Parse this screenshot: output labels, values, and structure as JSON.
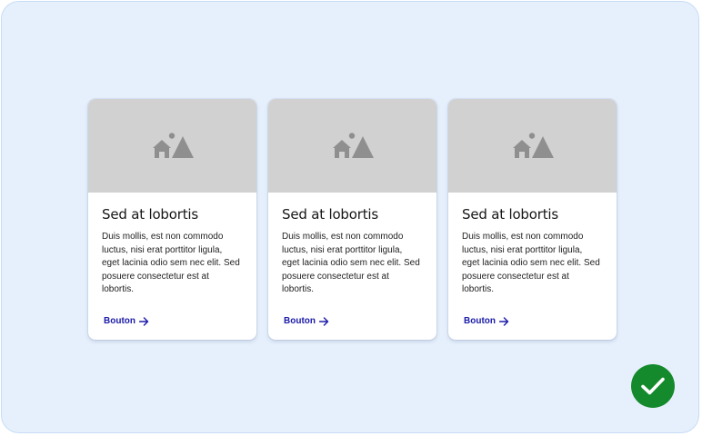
{
  "cards": [
    {
      "image_icon": "image-placeholder-icon",
      "title": "Sed at lobortis",
      "text": "Duis mollis, est non commodo\nluctus, nisi erat porttitor ligula,\neget lacinia odio sem nec elit. Sed\nposuere consectetur est at\nlobortis.",
      "link_label": "Bouton",
      "link_icon": "arrow-right-icon"
    },
    {
      "image_icon": "image-placeholder-icon",
      "title": "Sed at lobortis",
      "text": "Duis mollis, est non commodo\nluctus, nisi erat porttitor ligula,\neget lacinia odio sem nec elit. Sed\nposuere consectetur est at\nlobortis.",
      "link_label": "Bouton",
      "link_icon": "arrow-right-icon"
    },
    {
      "image_icon": "image-placeholder-icon",
      "title": "Sed at lobortis",
      "text": "Duis mollis, est non commodo\nluctus, nisi erat porttitor ligula,\neget lacinia odio sem nec elit. Sed\nposuere consectetur est at\nlobortis.",
      "link_label": "Bouton",
      "link_icon": "arrow-right-icon"
    }
  ],
  "status": {
    "icon": "check-circle-icon",
    "color": "#148a2c"
  },
  "colors": {
    "background": "#e6f0fc",
    "media_placeholder": "#d1d1d1",
    "link": "#1b1ba8"
  }
}
